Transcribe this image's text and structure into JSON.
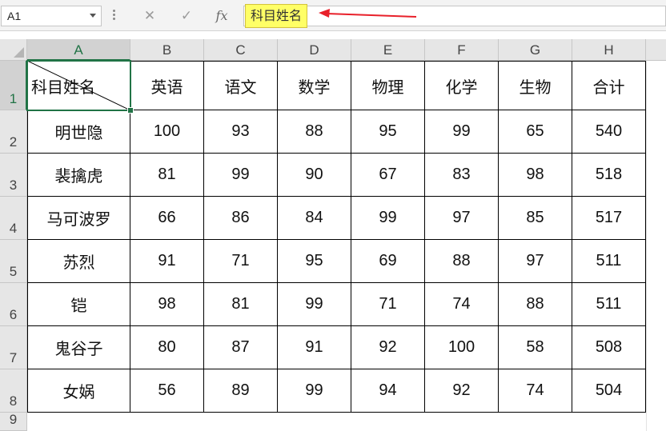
{
  "name_box": {
    "value": "A1"
  },
  "formula_bar": {
    "cancel_icon": "close-icon",
    "enter_icon": "check-icon",
    "fx_label": "fx",
    "value": "科目姓名",
    "highlight_color": "#ffff66",
    "annotation_arrow_color": "#e8202a"
  },
  "sheet": {
    "columns": [
      "A",
      "B",
      "C",
      "D",
      "E",
      "F",
      "G",
      "H"
    ],
    "rows": [
      "1",
      "2",
      "3",
      "4",
      "5",
      "6",
      "7",
      "8",
      "9"
    ],
    "selected_cell": "A1",
    "header_row": [
      "科目姓名",
      "英语",
      "语文",
      "数学",
      "物理",
      "化学",
      "生物",
      "合计"
    ],
    "data_rows": [
      [
        "明世隐",
        "100",
        "93",
        "88",
        "95",
        "99",
        "65",
        "540"
      ],
      [
        "裴擒虎",
        "81",
        "99",
        "90",
        "67",
        "83",
        "98",
        "518"
      ],
      [
        "马可波罗",
        "66",
        "86",
        "84",
        "99",
        "97",
        "85",
        "517"
      ],
      [
        "苏烈",
        "91",
        "71",
        "95",
        "69",
        "88",
        "97",
        "511"
      ],
      [
        "铠",
        "98",
        "81",
        "99",
        "71",
        "74",
        "88",
        "511"
      ],
      [
        "鬼谷子",
        "80",
        "87",
        "91",
        "92",
        "100",
        "58",
        "508"
      ],
      [
        "女娲",
        "56",
        "89",
        "99",
        "94",
        "92",
        "74",
        "504"
      ]
    ]
  }
}
